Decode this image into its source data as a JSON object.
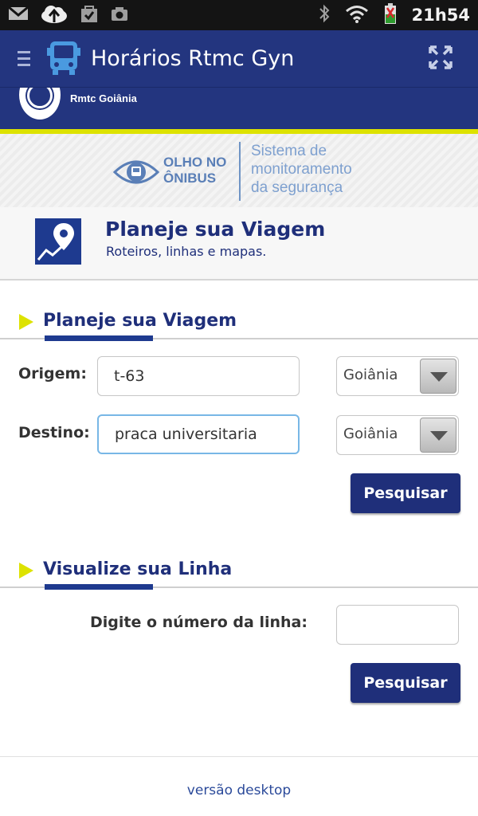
{
  "status_bar": {
    "time": "21h54",
    "icons": [
      "gmail-icon",
      "upload-icon",
      "shopping-bag-icon",
      "camera-icon",
      "bluetooth-icon",
      "wifi-icon",
      "battery-icon"
    ]
  },
  "action_bar": {
    "title": "Horários Rtmc Gyn",
    "icons": [
      "menu-icon",
      "bus-icon",
      "fullscreen-icon"
    ]
  },
  "site": {
    "brand": "Rmtc Goiânia"
  },
  "banner": {
    "olho_line1": "OLHO NO",
    "olho_line2": "ÔNIBUS",
    "sistema_line1": "Sistema de",
    "sistema_line2": "monitoramento",
    "sistema_line3": "da segurança"
  },
  "page_header": {
    "title": "Planeje sua Viagem",
    "subtitle": "Roteiros, linhas e mapas."
  },
  "plan_trip": {
    "heading": "Planeje sua Viagem",
    "origin_label": "Origem:",
    "origin_value": "t-63",
    "origin_city": "Goiânia",
    "destination_label": "Destino:",
    "destination_value": "praca universitaria",
    "destination_city": "Goiânia",
    "search_label": "Pesquisar"
  },
  "view_line": {
    "heading": "Visualize sua Linha",
    "line_label": "Digite o número da linha:",
    "line_value": "",
    "search_label": "Pesquisar"
  },
  "footer": {
    "desktop_link": "versão desktop"
  },
  "colors": {
    "primary": "#23357f",
    "accent_yellow": "#dde200",
    "link": "#2b4a9a"
  }
}
